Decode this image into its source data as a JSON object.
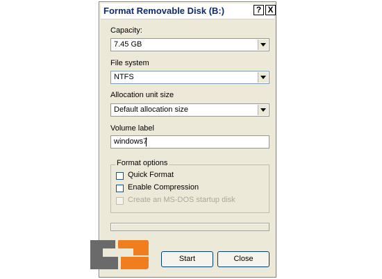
{
  "dialog": {
    "title": "Format Removable Disk (B:)",
    "help_button": "?",
    "close_button": "X"
  },
  "capacity": {
    "label": "Capacity:",
    "value": "7.45 GB"
  },
  "file_system": {
    "label": "File system",
    "value": "NTFS"
  },
  "allocation_unit": {
    "label": "Allocation unit size",
    "value": "Default allocation size"
  },
  "volume_label": {
    "label": "Volume label",
    "value": "windows7"
  },
  "format_options": {
    "title": "Format options",
    "options": [
      {
        "label": "Quick Format",
        "checked": false,
        "enabled": true
      },
      {
        "label": "Enable Compression",
        "checked": false,
        "enabled": true
      },
      {
        "label": "Create an MS-DOS startup disk",
        "checked": false,
        "enabled": false
      }
    ]
  },
  "progress": {
    "value": 0
  },
  "buttons": {
    "start": "Start",
    "close": "Close"
  },
  "colors": {
    "dialog_bg": "#ece9d8",
    "title_text": "#0b2a6f",
    "input_border": "#7f9db9",
    "logo_orange": "#f07d1e",
    "logo_dark": "#6a6a6a"
  }
}
